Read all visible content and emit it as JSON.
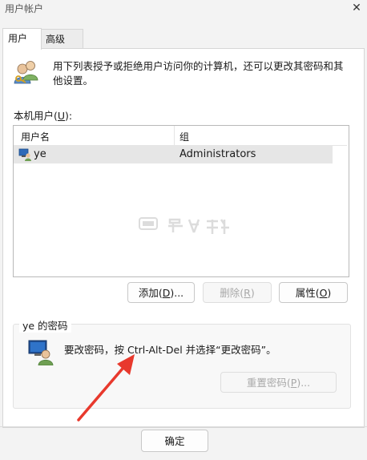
{
  "window": {
    "title": "用户帐户",
    "close_glyph": "✕"
  },
  "tabs": [
    {
      "label": "用户",
      "active": true
    },
    {
      "label": "高级",
      "active": false
    }
  ],
  "intro_text": "用下列表授予或拒绝用户访问你的计算机，还可以更改其密码和其他设置。",
  "users_list": {
    "label_prefix": "本机用户(",
    "label_key": "U",
    "label_suffix": "):",
    "columns": [
      "用户名",
      "组"
    ],
    "rows": [
      {
        "name": "ye",
        "group": "Administrators",
        "selected": true
      }
    ]
  },
  "list_buttons": [
    {
      "prefix": "添加(",
      "key": "D",
      "suffix": ")...",
      "enabled": true
    },
    {
      "prefix": "删除(",
      "key": "R",
      "suffix": ")",
      "enabled": false
    },
    {
      "prefix": "属性(",
      "key": "O",
      "suffix": ")",
      "enabled": true
    }
  ],
  "password_group": {
    "title": "ye 的密码",
    "message": "要改密码，按 Ctrl-Alt-Del 并选择“更改密码”。",
    "reset_button": {
      "prefix": "重置密码(",
      "key": "P",
      "suffix": ")...",
      "enabled": false
    }
  },
  "footer": {
    "ok_label": "确定"
  },
  "colors": {
    "arrow": "#e8392d",
    "selection": "#e6e6e6"
  }
}
